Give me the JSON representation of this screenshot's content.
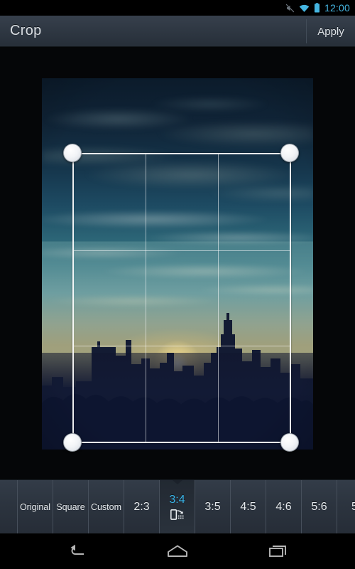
{
  "status_bar": {
    "time": "12:00",
    "icons": [
      "mute-icon",
      "wifi-icon",
      "battery-icon"
    ],
    "clock_color": "#45b5e0"
  },
  "action_bar": {
    "title": "Crop",
    "apply_label": "Apply"
  },
  "photo": {
    "description": "City skyline silhouette at sunset with golden glow and wispy clouds",
    "alt": "sunset-skyline-photo"
  },
  "crop_overlay": {
    "grid": "rule-of-thirds",
    "handles": [
      "top-left",
      "top-right",
      "bottom-left",
      "bottom-right"
    ],
    "frame_color": "#ffffff"
  },
  "ratio_strip": {
    "selected": "3:4",
    "selected_color": "#38b4e8",
    "items": [
      {
        "label": "",
        "type": "partial"
      },
      {
        "label": "Original",
        "type": "named"
      },
      {
        "label": "Square",
        "type": "named"
      },
      {
        "label": "Custom",
        "type": "named"
      },
      {
        "label": "2:3",
        "type": "num"
      },
      {
        "label": "3:4",
        "type": "num",
        "selected": true,
        "icon": "rotate-orientation-icon"
      },
      {
        "label": "3:5",
        "type": "num"
      },
      {
        "label": "4:5",
        "type": "num"
      },
      {
        "label": "4:6",
        "type": "num"
      },
      {
        "label": "5:6",
        "type": "num"
      },
      {
        "label": "5",
        "type": "partial-right"
      }
    ]
  },
  "nav_bar": {
    "buttons": [
      "back-icon",
      "home-icon",
      "recents-icon"
    ]
  }
}
